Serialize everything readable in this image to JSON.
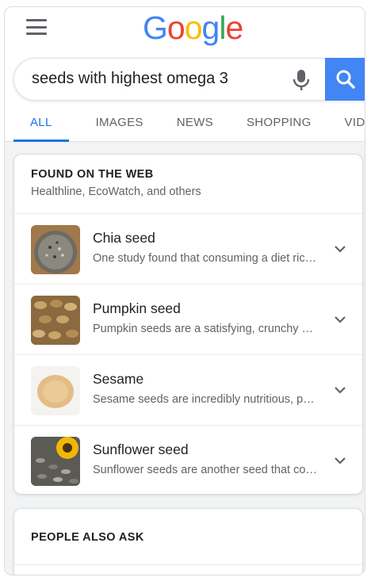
{
  "logo": {
    "letters": [
      "G",
      "o",
      "o",
      "g",
      "l",
      "e"
    ],
    "colors": [
      "#4285f4",
      "#ea4335",
      "#fbbc05",
      "#4285f4",
      "#34a853",
      "#ea4335"
    ]
  },
  "search": {
    "query": "seeds with highest omega 3",
    "accent": "#4285f4"
  },
  "tabs": [
    {
      "label": "ALL",
      "active": true
    },
    {
      "label": "IMAGES"
    },
    {
      "label": "NEWS"
    },
    {
      "label": "SHOPPING"
    },
    {
      "label": "VIDEOS"
    }
  ],
  "web_card": {
    "title": "FOUND ON THE WEB",
    "subtitle": "Healthline, EcoWatch, and others",
    "items": [
      {
        "title": "Chia seed",
        "desc": "One study found that consuming a diet rich in chia seeds",
        "icon": "chia-seed-thumbnail"
      },
      {
        "title": "Pumpkin seed",
        "desc": "Pumpkin seeds are a satisfying, crunchy snack",
        "icon": "pumpkin-seed-thumbnail"
      },
      {
        "title": "Sesame",
        "desc": "Sesame seeds are incredibly nutritious, packed with",
        "icon": "sesame-thumbnail"
      },
      {
        "title": "Sunflower seed",
        "desc": "Sunflower seeds are another seed that contains",
        "icon": "sunflower-seed-thumbnail"
      }
    ]
  },
  "paa": {
    "title": "PEOPLE ALSO ASK"
  }
}
